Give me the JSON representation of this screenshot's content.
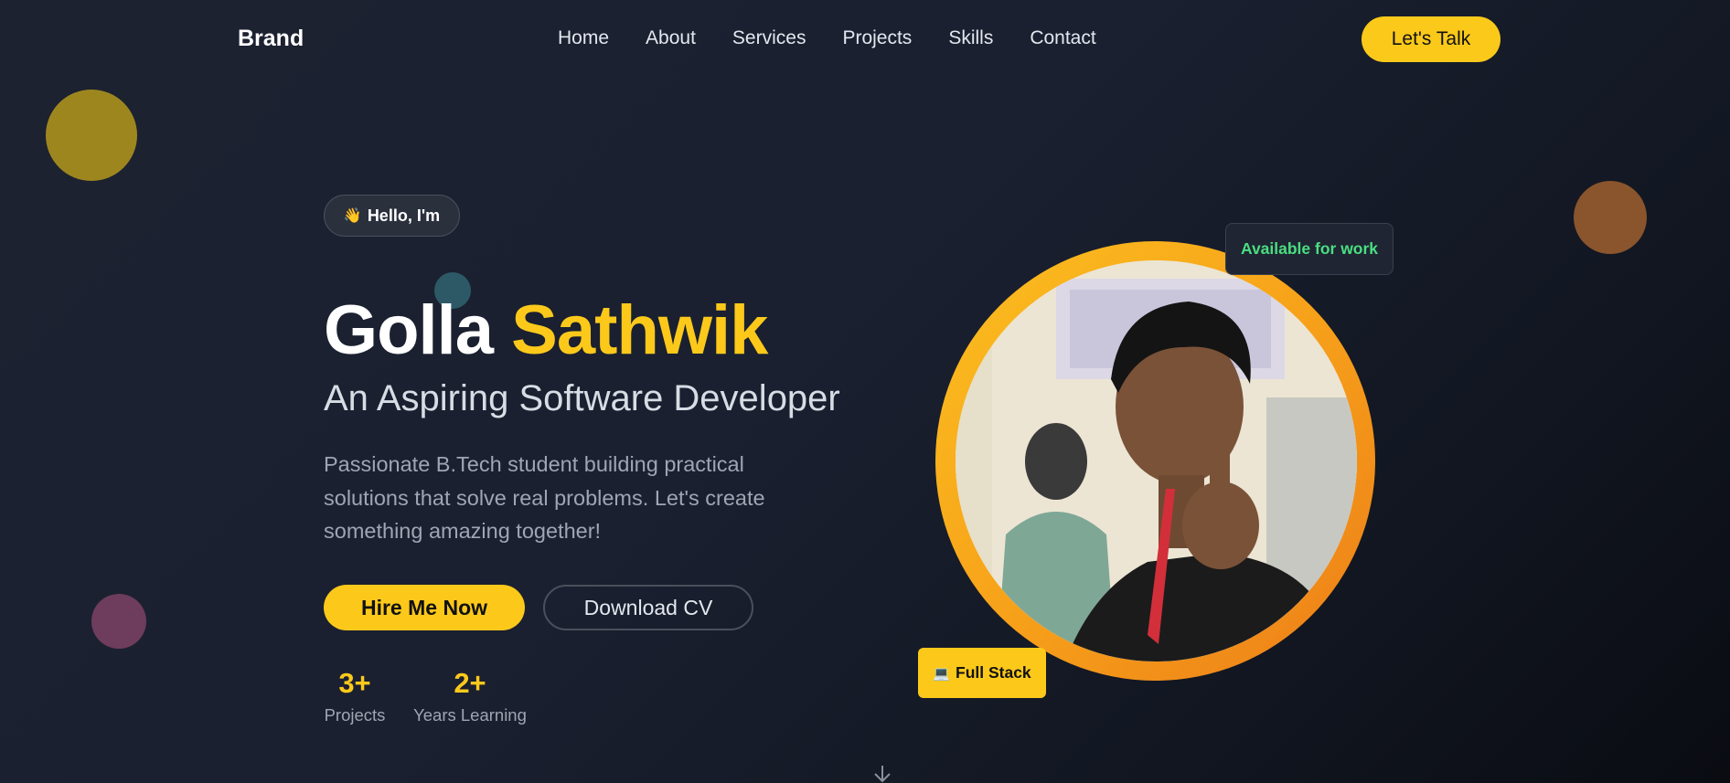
{
  "nav": {
    "brand": "Brand",
    "links": [
      "Home",
      "About",
      "Services",
      "Projects",
      "Skills",
      "Contact"
    ],
    "cta": "Let's Talk"
  },
  "hero": {
    "greeting_icon": "👋",
    "greeting": "Hello, I'm",
    "first_name": "Golla",
    "last_name": "Sathwik",
    "subtitle": "An Aspiring Software Developer",
    "description": "Passionate B.Tech student building practical solutions that solve real problems. Let's create something amazing together!",
    "hire_button": "Hire Me Now",
    "cv_button": "Download CV",
    "stats": [
      {
        "value": "3+",
        "label": "Projects"
      },
      {
        "value": "2+",
        "label": "Years Learning"
      }
    ]
  },
  "profile": {
    "availability_badge": "Available for work",
    "tag_icon": "💻",
    "tag": "Full Stack"
  },
  "icons": {
    "scroll": "arrow-down-icon",
    "greeting": "waving-hand-icon",
    "tag": "laptop-icon"
  },
  "colors": {
    "accent": "#fcc91b",
    "availability": "#4ade80",
    "background": "#1a2030"
  }
}
